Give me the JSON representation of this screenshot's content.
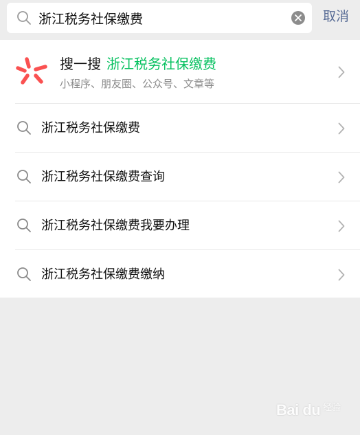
{
  "search": {
    "value": "浙江税务社保缴费",
    "cancel_label": "取消"
  },
  "souyisou": {
    "label": "搜一搜",
    "keyword": "浙江税务社保缴费",
    "scope": "小程序、朋友圈、公众号、文章等"
  },
  "suggestions": [
    {
      "text": "浙江税务社保缴费"
    },
    {
      "text": "浙江税务社保缴费查询"
    },
    {
      "text": "浙江税务社保缴费我要办理"
    },
    {
      "text": "浙江税务社保缴费缴纳"
    }
  ],
  "watermark": {
    "brand": "Bai du",
    "sub": "经验"
  },
  "colors": {
    "keyword_green": "#07c160",
    "cancel_blue": "#576b95",
    "logo_red": "#fa5151"
  },
  "icons": {
    "search": "search-icon",
    "clear": "clear-icon",
    "chevron": "chevron-right-icon",
    "logo": "souyisou-logo-icon"
  }
}
